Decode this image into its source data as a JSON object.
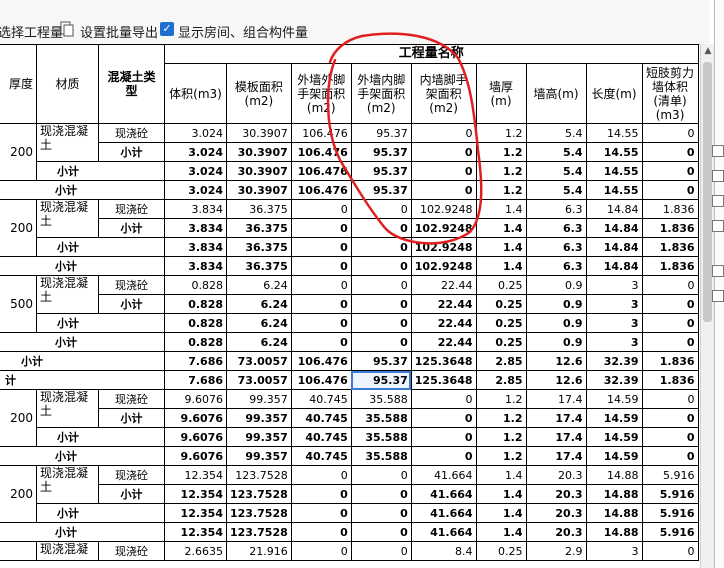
{
  "toolbar": {
    "select_label": "选择工程量",
    "batch_export_label": "设置批量导出",
    "show_rooms_label": "显示房间、组合构件量",
    "show_rooms_checked": true
  },
  "table": {
    "group_header": "工程量名称",
    "headers": [
      "厚度",
      "材质",
      "混凝土类型",
      "体积(m3)",
      "模板面积(m2)",
      "外墙外脚手架面积(m2)",
      "外墙内脚手架面积(m2)",
      "内墙脚手架面积(m2)",
      "墙厚(m)",
      "墙高(m)",
      "长度(m)",
      "短肢剪力墙体积(清单)(m3)"
    ],
    "rows": [
      {
        "type": "detail",
        "thick": "200",
        "mat": "现浇混凝土",
        "ctype": "现浇砼",
        "vals": [
          "3.024",
          "30.3907",
          "106.476",
          "95.37",
          "0",
          "1.2",
          "5.4",
          "14.55",
          "0"
        ]
      },
      {
        "type": "sub3",
        "label": "小计",
        "vals": [
          "3.024",
          "30.3907",
          "106.476",
          "95.37",
          "0",
          "1.2",
          "5.4",
          "14.55",
          "0"
        ]
      },
      {
        "type": "sub2",
        "label": "小计",
        "vals": [
          "3.024",
          "30.3907",
          "106.476",
          "95.37",
          "0",
          "1.2",
          "5.4",
          "14.55",
          "0"
        ]
      },
      {
        "type": "sub1",
        "label": "小计",
        "vals": [
          "3.024",
          "30.3907",
          "106.476",
          "95.37",
          "0",
          "1.2",
          "5.4",
          "14.55",
          "0"
        ]
      },
      {
        "type": "detail",
        "thick": "200",
        "mat": "现浇混凝土",
        "ctype": "现浇砼",
        "vals": [
          "3.834",
          "36.375",
          "0",
          "0",
          "102.9248",
          "1.4",
          "6.3",
          "14.84",
          "1.836"
        ]
      },
      {
        "type": "sub3",
        "label": "小计",
        "vals": [
          "3.834",
          "36.375",
          "0",
          "0",
          "102.9248",
          "1.4",
          "6.3",
          "14.84",
          "1.836"
        ]
      },
      {
        "type": "sub2",
        "label": "小计",
        "vals": [
          "3.834",
          "36.375",
          "0",
          "0",
          "102.9248",
          "1.4",
          "6.3",
          "14.84",
          "1.836"
        ]
      },
      {
        "type": "sub1",
        "label": "小计",
        "vals": [
          "3.834",
          "36.375",
          "0",
          "0",
          "102.9248",
          "1.4",
          "6.3",
          "14.84",
          "1.836"
        ]
      },
      {
        "type": "detail",
        "thick": "500",
        "mat": "现浇混凝土",
        "ctype": "现浇砼",
        "vals": [
          "0.828",
          "6.24",
          "0",
          "0",
          "22.44",
          "0.25",
          "0.9",
          "3",
          "0"
        ]
      },
      {
        "type": "sub3",
        "label": "小计",
        "vals": [
          "0.828",
          "6.24",
          "0",
          "0",
          "22.44",
          "0.25",
          "0.9",
          "3",
          "0"
        ]
      },
      {
        "type": "sub2",
        "label": "小计",
        "vals": [
          "0.828",
          "6.24",
          "0",
          "0",
          "22.44",
          "0.25",
          "0.9",
          "3",
          "0"
        ]
      },
      {
        "type": "sub1",
        "label": "小计",
        "vals": [
          "0.828",
          "6.24",
          "0",
          "0",
          "22.44",
          "0.25",
          "0.9",
          "3",
          "0"
        ]
      },
      {
        "type": "sub0",
        "label": "小计",
        "vals": [
          "7.686",
          "73.0057",
          "106.476",
          "95.37",
          "125.3648",
          "2.85",
          "12.6",
          "32.39",
          "1.836"
        ]
      },
      {
        "type": "total",
        "label": "计",
        "vals": [
          "7.686",
          "73.0057",
          "106.476",
          "95.37",
          "125.3648",
          "2.85",
          "12.6",
          "32.39",
          "1.836"
        ]
      },
      {
        "type": "detail",
        "thick": "200",
        "mat": "现浇混凝土",
        "ctype": "现浇砼",
        "vals": [
          "9.6076",
          "99.357",
          "40.745",
          "35.588",
          "0",
          "1.2",
          "17.4",
          "14.59",
          "0"
        ]
      },
      {
        "type": "sub3",
        "label": "小计",
        "vals": [
          "9.6076",
          "99.357",
          "40.745",
          "35.588",
          "0",
          "1.2",
          "17.4",
          "14.59",
          "0"
        ]
      },
      {
        "type": "sub2",
        "label": "小计",
        "vals": [
          "9.6076",
          "99.357",
          "40.745",
          "35.588",
          "0",
          "1.2",
          "17.4",
          "14.59",
          "0"
        ]
      },
      {
        "type": "sub1",
        "label": "小计",
        "vals": [
          "9.6076",
          "99.357",
          "40.745",
          "35.588",
          "0",
          "1.2",
          "17.4",
          "14.59",
          "0"
        ]
      },
      {
        "type": "detail",
        "thick": "200",
        "mat": "现浇混凝土",
        "ctype": "现浇砼",
        "vals": [
          "12.354",
          "123.7528",
          "0",
          "0",
          "41.664",
          "1.4",
          "20.3",
          "14.88",
          "5.916"
        ]
      },
      {
        "type": "sub3",
        "label": "小计",
        "vals": [
          "12.354",
          "123.7528",
          "0",
          "0",
          "41.664",
          "1.4",
          "20.3",
          "14.88",
          "5.916"
        ]
      },
      {
        "type": "sub2",
        "label": "小计",
        "vals": [
          "12.354",
          "123.7528",
          "0",
          "0",
          "41.664",
          "1.4",
          "20.3",
          "14.88",
          "5.916"
        ]
      },
      {
        "type": "sub1",
        "label": "小计",
        "vals": [
          "12.354",
          "123.7528",
          "0",
          "0",
          "41.664",
          "1.4",
          "20.3",
          "14.88",
          "5.916"
        ]
      },
      {
        "type": "detail",
        "thick": "",
        "mat": "现浇混凝",
        "ctype": "现浇砼",
        "vals": [
          "2.6635",
          "21.916",
          "0",
          "0",
          "8.4",
          "0.25",
          "2.9",
          "3",
          "0"
        ]
      }
    ]
  },
  "annotation": {
    "color": "#e02020"
  }
}
